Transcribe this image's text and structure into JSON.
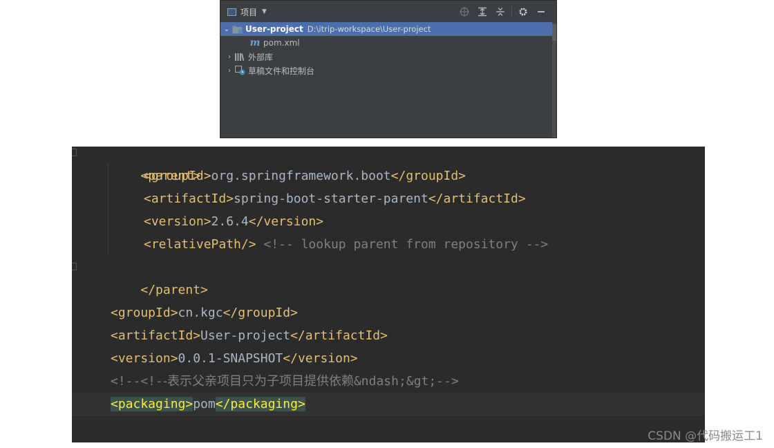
{
  "project_panel": {
    "title": "项目",
    "toolbar_icons": [
      "locate-icon",
      "expand-all-icon",
      "collapse-all-icon",
      "gear-icon",
      "minimize-icon"
    ],
    "tree": {
      "root": {
        "name": "User-project",
        "path": "D:\\itrip-workspace\\User-project"
      },
      "pom": "pom.xml",
      "external_libs": "外部库",
      "scratches": "草稿文件和控制台"
    }
  },
  "editor": {
    "lines": {
      "l1": {
        "open": "<parent>"
      },
      "l2": {
        "open": "<groupId>",
        "text": "org.springframework.boot",
        "close": "</groupId>"
      },
      "l3": {
        "open": "<artifactId>",
        "text": "spring-boot-starter-parent",
        "close": "</artifactId>"
      },
      "l4": {
        "open": "<version>",
        "text": "2.6.4",
        "close": "</version>"
      },
      "l5": {
        "tag": "<relativePath/>",
        "comment": "<!-- lookup parent from repository -->"
      },
      "l6": {
        "close": "</parent>"
      },
      "l8": {
        "open": "<groupId>",
        "text": "cn.kgc",
        "close": "</groupId>"
      },
      "l9": {
        "open": "<artifactId>",
        "text": "User-project",
        "close": "</artifactId>"
      },
      "l10": {
        "open": "<version>",
        "text": "0.0.1-SNAPSHOT",
        "close": "</version>"
      },
      "l11": {
        "comment_a": "<!--<!-",
        "comment_cjk": "-表示父亲项目只为子项目提供依赖",
        "comment_b": "&ndash;&gt;-->"
      },
      "l12": {
        "open": "<packaging>",
        "text": "pom",
        "close": "</packaging>"
      }
    }
  },
  "watermark": "CSDN @代码搬运工1"
}
